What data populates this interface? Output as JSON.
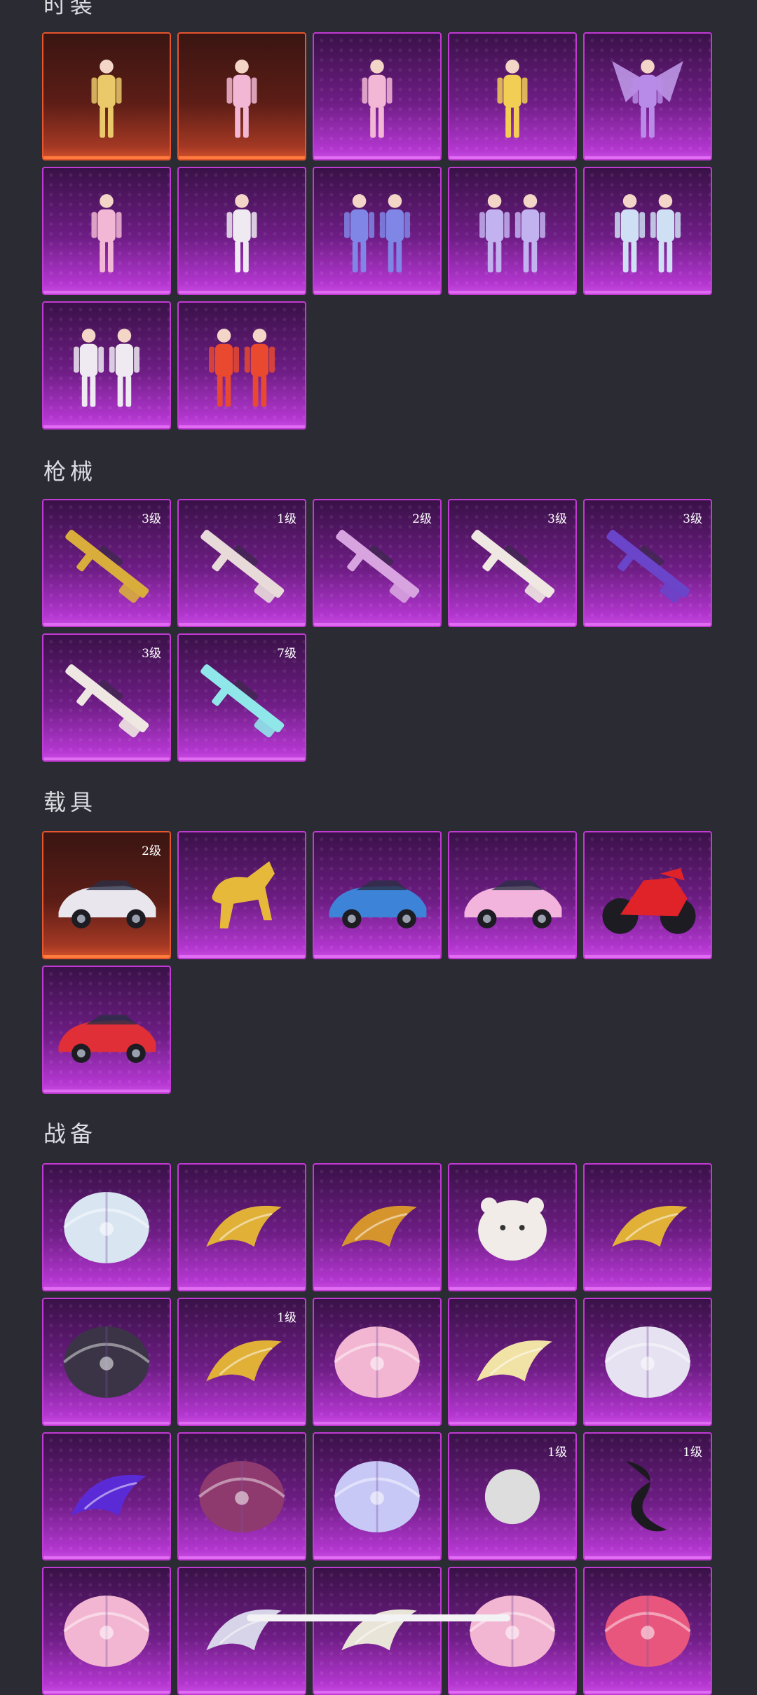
{
  "sections": {
    "outfits": {
      "title": "时装",
      "items": [
        {
          "icon": "golden-mummy-outfit-icon",
          "badge": "",
          "rarity": "red"
        },
        {
          "icon": "pink-dress-outfit-icon",
          "badge": "",
          "rarity": "red"
        },
        {
          "icon": "pink-doll-outfit-icon",
          "badge": "",
          "rarity": "purple"
        },
        {
          "icon": "yellow-hoodie-outfit-icon",
          "badge": "",
          "rarity": "purple"
        },
        {
          "icon": "winged-fairy-outfit-icon",
          "badge": "",
          "rarity": "purple"
        },
        {
          "icon": "pink-angel-outfit-icon",
          "badge": "",
          "rarity": "purple"
        },
        {
          "icon": "white-gown-outfit-icon",
          "badge": "",
          "rarity": "purple"
        },
        {
          "icon": "blue-uniform-pair-outfit-icon",
          "badge": "",
          "rarity": "purple"
        },
        {
          "icon": "bodysuit-pair-outfit-icon",
          "badge": "",
          "rarity": "purple"
        },
        {
          "icon": "hanfu-set-outfit-icon",
          "badge": "",
          "rarity": "purple"
        },
        {
          "icon": "white-set-outfit-icon",
          "badge": "",
          "rarity": "purple"
        },
        {
          "icon": "red-armor-set-outfit-icon",
          "badge": "",
          "rarity": "purple"
        }
      ]
    },
    "guns": {
      "title": "枪械",
      "items": [
        {
          "icon": "gold-rifle-icon",
          "badge": "3级",
          "rarity": "purple"
        },
        {
          "icon": "kar98-rifle-icon",
          "badge": "1级",
          "rarity": "purple"
        },
        {
          "icon": "pink-wrapped-gun-icon",
          "badge": "2级",
          "rarity": "purple"
        },
        {
          "icon": "white-akm-icon",
          "badge": "3级",
          "rarity": "purple"
        },
        {
          "icon": "purple-smg-icon",
          "badge": "3级",
          "rarity": "purple"
        },
        {
          "icon": "white-sniper-icon",
          "badge": "3级",
          "rarity": "purple"
        },
        {
          "icon": "ice-rifle-icon",
          "badge": "7级",
          "rarity": "purple"
        }
      ]
    },
    "vehicles": {
      "title": "载具",
      "items": [
        {
          "icon": "white-suv-icon",
          "badge": "2级",
          "rarity": "red"
        },
        {
          "icon": "golden-qilin-icon",
          "badge": "",
          "rarity": "purple"
        },
        {
          "icon": "blue-convertible-icon",
          "badge": "",
          "rarity": "purple"
        },
        {
          "icon": "pink-sports-car-icon",
          "badge": "",
          "rarity": "purple"
        },
        {
          "icon": "red-motorcycle-icon",
          "badge": "",
          "rarity": "purple"
        },
        {
          "icon": "red-supercar-icon",
          "badge": "",
          "rarity": "purple"
        }
      ]
    },
    "gear": {
      "title": "战备",
      "items": [
        {
          "icon": "pastel-parachute-icon",
          "badge": "",
          "rarity": "purple"
        },
        {
          "icon": "golden-glider-icon",
          "badge": "",
          "rarity": "purple"
        },
        {
          "icon": "fire-phoenix-glider-icon",
          "badge": "",
          "rarity": "purple"
        },
        {
          "icon": "white-bear-pet-icon",
          "badge": "",
          "rarity": "purple"
        },
        {
          "icon": "golden-leaf-glider-icon",
          "badge": "",
          "rarity": "purple"
        },
        {
          "icon": "dark-ornate-parachute-icon",
          "badge": "",
          "rarity": "purple"
        },
        {
          "icon": "golden-pegasus-carriage-icon",
          "badge": "1级",
          "rarity": "purple"
        },
        {
          "icon": "pink-bow-parachute-icon",
          "badge": "",
          "rarity": "purple"
        },
        {
          "icon": "flower-glider-icon",
          "badge": "",
          "rarity": "purple"
        },
        {
          "icon": "white-striped-parachute-icon",
          "badge": "",
          "rarity": "purple"
        },
        {
          "icon": "portal-trail-icon",
          "badge": "",
          "rarity": "purple"
        },
        {
          "icon": "patterned-kite-icon",
          "badge": "",
          "rarity": "purple"
        },
        {
          "icon": "jellyfish-parachute-icon",
          "badge": "",
          "rarity": "purple"
        },
        {
          "icon": "jellyfish-pet-icon",
          "badge": "1级",
          "rarity": "purple"
        },
        {
          "icon": "black-dragon-icon",
          "badge": "1级",
          "rarity": "purple"
        },
        {
          "icon": "pink-lace-parachute-icon",
          "badge": "",
          "rarity": "purple"
        },
        {
          "icon": "crystal-glider-icon",
          "badge": "",
          "rarity": "purple"
        },
        {
          "icon": "feather-glider-icon",
          "badge": "",
          "rarity": "purple"
        },
        {
          "icon": "pink-floral-parachute-icon",
          "badge": "",
          "rarity": "purple"
        },
        {
          "icon": "red-parasol-parachute-icon",
          "badge": "",
          "rarity": "purple"
        }
      ]
    }
  }
}
